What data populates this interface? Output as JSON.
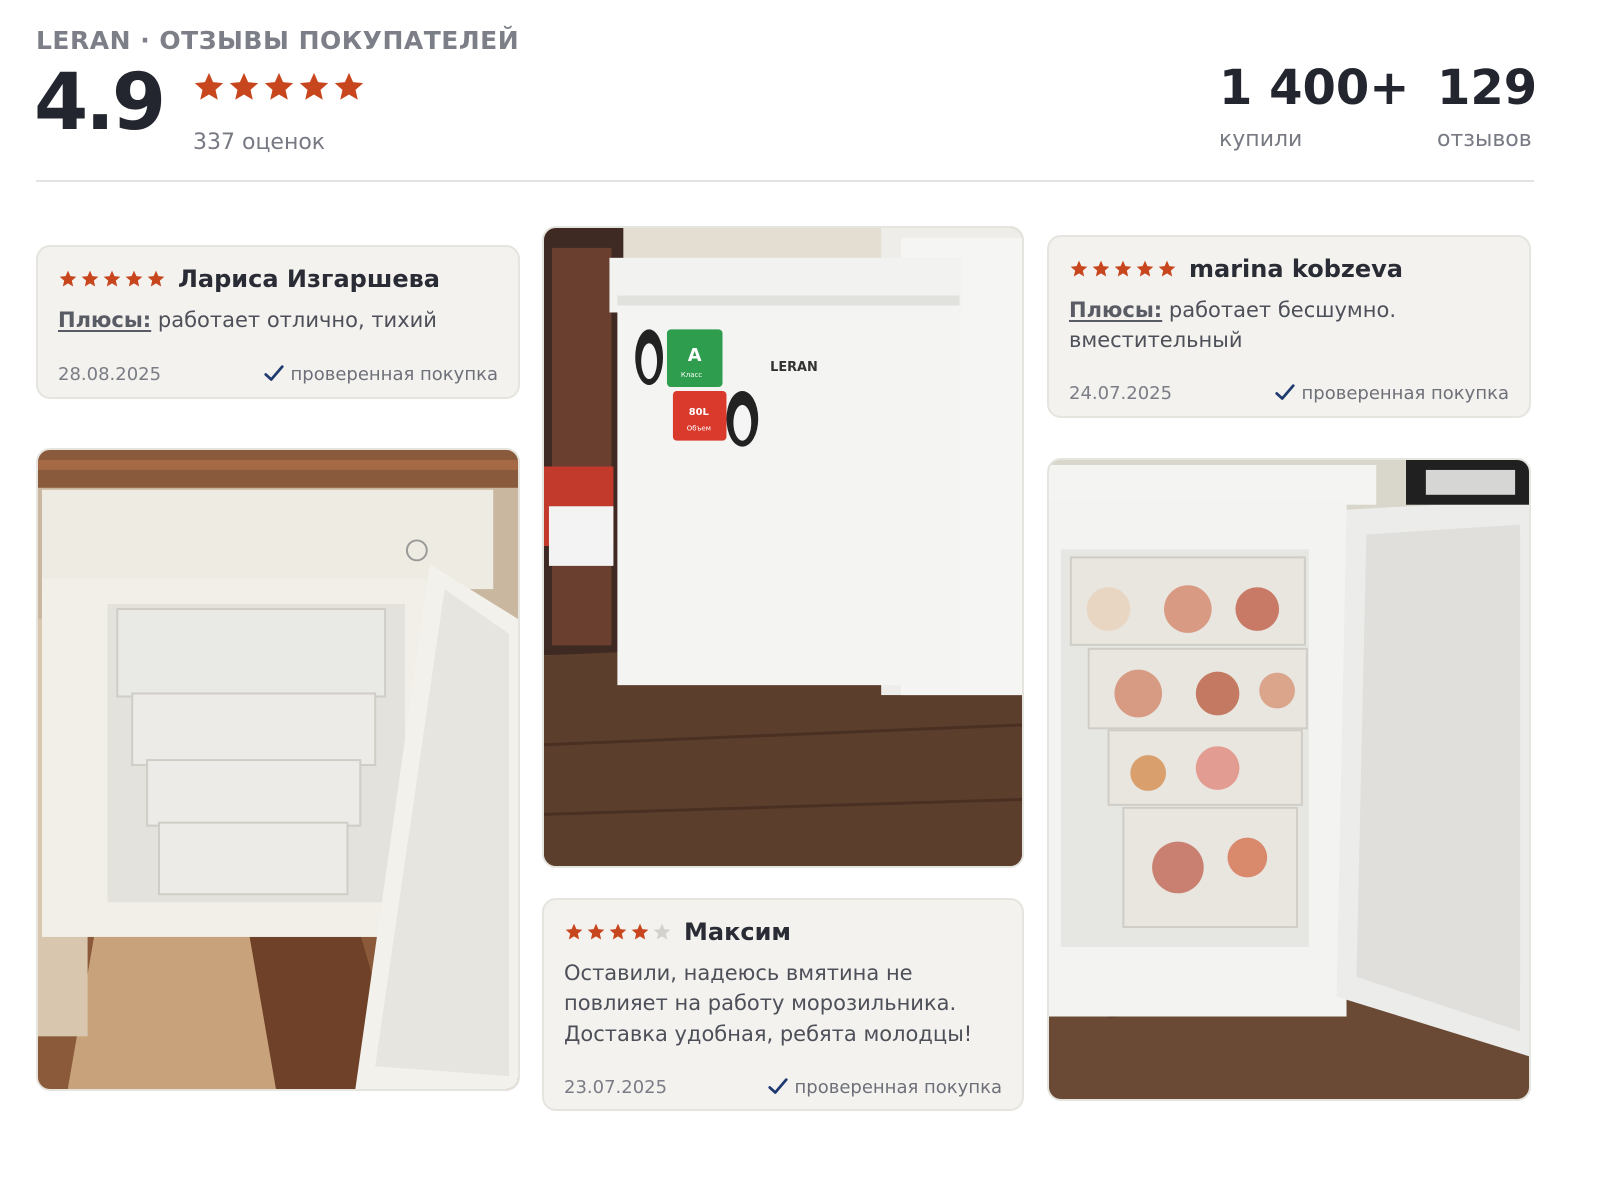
{
  "header": {
    "brand": "LERAN · ОТЗЫВЫ ПОКУПАТЕЛЕЙ",
    "score": "4.9",
    "stars": 5,
    "ratings_count": "337 оценок",
    "stats": [
      {
        "value": "1 400+",
        "label": "купили"
      },
      {
        "value": "129",
        "label": "отзывов"
      }
    ]
  },
  "reviews": [
    {
      "author": "Лариса Изгаршева",
      "rating": 5,
      "pros_label": "Плюсы:",
      "text": "работает отлично, тихий",
      "date": "28.08.2025",
      "verified": "проверенная покупка"
    },
    {
      "author": "Максим",
      "rating": 4,
      "text": "Оставили, надеюсь вмятина не повлияет на работу морозильника. Доставка удобная, ребята молодцы!",
      "date": "23.07.2025",
      "verified": "проверенная покупка"
    },
    {
      "author": "marina kobzeva",
      "rating": 5,
      "pros_label": "Плюсы:",
      "text": "работает бесшумно. вместительный",
      "date": "24.07.2025",
      "verified": "проверенная покупка"
    }
  ],
  "photos": {
    "freezer_brand": "LERAN",
    "sticker_energy_letter": "A",
    "sticker_energy_text": "Класс",
    "sticker_volume": "80L",
    "sticker_volume_text": "Объем"
  },
  "colors": {
    "star": "#c8461e",
    "star_empty": "#d4d2cd",
    "check": "#1f3a6e",
    "card_bg": "#f3f2ef"
  },
  "icons": {
    "star": "star-icon",
    "verified": "checkmark-icon"
  }
}
